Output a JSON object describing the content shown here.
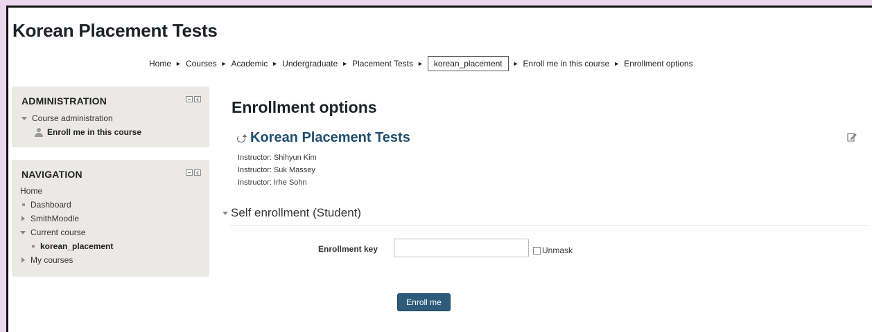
{
  "site": {
    "title": "Korean Placement Tests"
  },
  "breadcrumb": {
    "items": [
      "Home",
      "Courses",
      "Academic",
      "Undergraduate",
      "Placement Tests",
      "korean_placement",
      "Enroll me in this course",
      "Enrollment options"
    ],
    "separator": "►"
  },
  "administration": {
    "title": "ADMINISTRATION",
    "course_admin": "Course administration",
    "enroll_link": "Enroll me in this course"
  },
  "navigation": {
    "title": "NAVIGATION",
    "home": "Home",
    "dashboard": "Dashboard",
    "site": "SmithMoodle",
    "current_course": "Current course",
    "course_short": "korean_placement",
    "my_courses": "My courses"
  },
  "main": {
    "heading": "Enrollment options",
    "course_title": "Korean Placement Tests",
    "instructors": [
      "Instructor: Shihyun Kim",
      "Instructor: Suk Massey",
      "Instructor: Irhe Sohn"
    ],
    "section_title": "Self enrollment (Student)",
    "enrollment_key_label": "Enrollment key",
    "enrollment_key_value": "",
    "unmask_label": "Unmask",
    "enroll_button": "Enroll me"
  },
  "icons": {
    "course": "course-icon",
    "edit": "edit-settings-icon",
    "user": "user-icon"
  }
}
